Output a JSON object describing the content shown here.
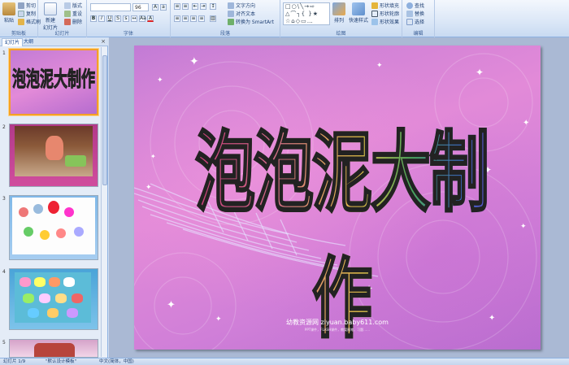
{
  "ribbon": {
    "clipboard": {
      "paste": "粘贴",
      "cut": "剪切",
      "copy": "复制",
      "format_painter": "格式刷",
      "label": "剪贴板"
    },
    "slides": {
      "new_slide": "新建\n幻灯片",
      "layout": "版式",
      "reset": "重设",
      "delete": "删除",
      "label": "幻灯片"
    },
    "font": {
      "size": "96",
      "label": "字体"
    },
    "paragraph": {
      "text_direction": "文字方向",
      "align_text": "对齐文本",
      "smartart": "转换为 SmartArt",
      "label": "段落"
    },
    "drawing": {
      "arrange": "排列",
      "quick_styles": "快速样式",
      "shape_fill": "形状填充",
      "shape_outline": "形状轮廓",
      "shape_effects": "形状效果",
      "label": "绘图"
    },
    "editing": {
      "find": "查找",
      "replace": "替换",
      "select": "选择",
      "label": "编辑"
    }
  },
  "left_pane": {
    "tabs": [
      "幻灯片",
      "大纲"
    ],
    "close": "×",
    "thumbnails": [
      {
        "num": "1",
        "title": "泡泡泥大制作"
      },
      {
        "num": "2"
      },
      {
        "num": "3"
      },
      {
        "num": "4"
      },
      {
        "num": "5"
      }
    ]
  },
  "slide": {
    "title": "泡泡泥大制作",
    "footer": "幼教资源网 ziyuan.baby611.com",
    "footer_sub": "PPT课件，FLASH课件，教案随笔，习题……"
  },
  "statusbar": {
    "slide_count": "幻灯片 1/9",
    "theme": "\"默认设计模板\"",
    "language": "中文(简体，中国)"
  },
  "colors": {
    "ribbon_bg": "#dbe7f7",
    "selected_thumb_border": "#f4a028",
    "editor_bg": "#aab9d4"
  }
}
